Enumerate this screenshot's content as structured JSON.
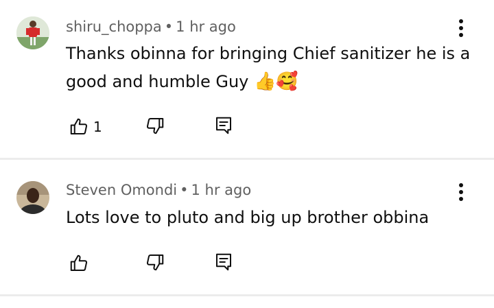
{
  "comments": [
    {
      "author": "shiru_choppa",
      "time": "1 hr ago",
      "text": "Thanks obinna for bringing Chief sanitizer he is a good and humble Guy",
      "emojis": "👍🥰",
      "like_count": "1"
    },
    {
      "author": "Steven Omondi",
      "time": "1 hr ago",
      "text": "Lots love to pluto and big up brother obbina",
      "like_count": ""
    }
  ],
  "separator": "•",
  "icons": [
    "thumb-up-icon",
    "thumb-down-icon",
    "reply-icon",
    "more-vert-icon"
  ],
  "colors": {
    "meta": "#606060",
    "text": "#0f0f0f",
    "divider": "#ececec"
  }
}
